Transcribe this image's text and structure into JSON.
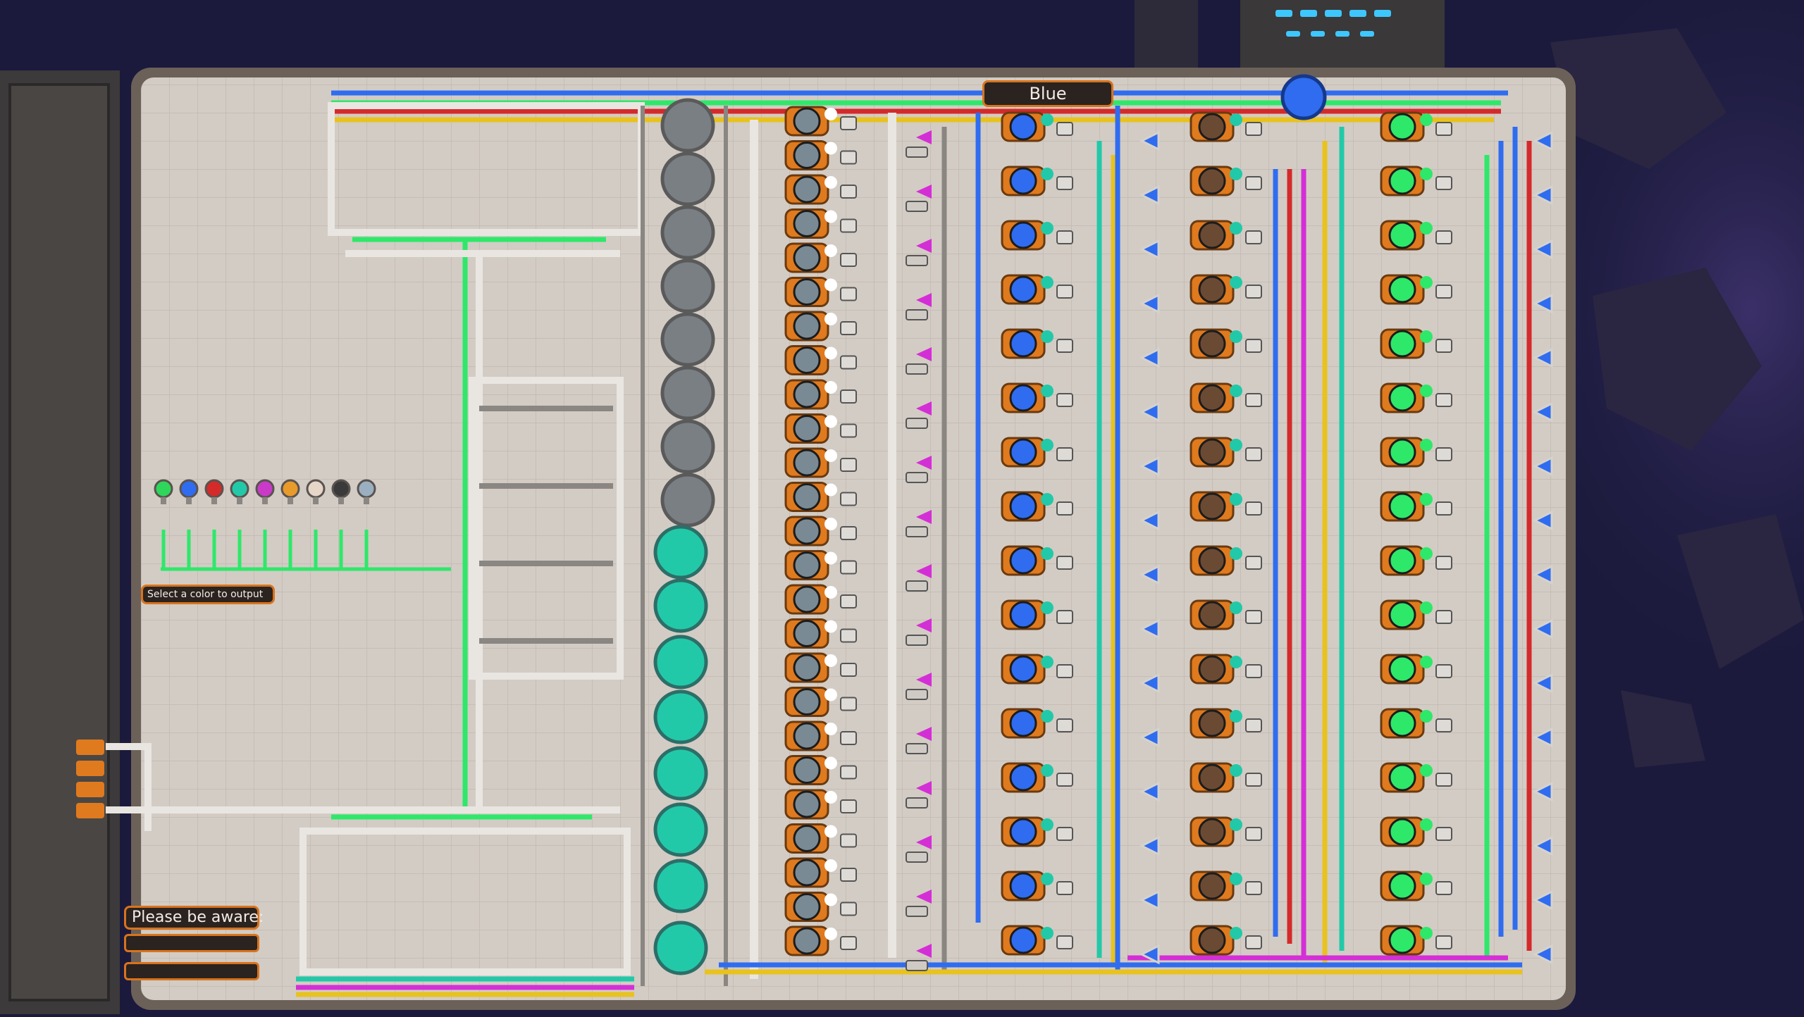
{
  "signs": {
    "color_selected": "Blue",
    "select_prompt": "Select a color to output",
    "warning_title": "Please be aware:",
    "note_1": "",
    "note_2": ""
  },
  "palette": {
    "space": "#1b1a3c",
    "floor": "#cfc8c0",
    "frame": "#6b6158",
    "pipe_white": "#e9e6e2",
    "pipe_green": "#2ee86a",
    "pipe_blue": "#2f6cf0",
    "pipe_red": "#d42a2a",
    "pipe_yellow": "#e8c21e",
    "pipe_magenta": "#d42fd6",
    "pipe_teal": "#22c9a8",
    "machine_orange": "#e07a1e",
    "sign_border": "#d9731c"
  },
  "color_selector": {
    "swatches": [
      "#2ed65a",
      "#2f6cf0",
      "#d42a2a",
      "#22c9a8",
      "#c93ac9",
      "#e89a2a",
      "#e6d6c8",
      "#3a3a3a",
      "#9ab0c0"
    ]
  },
  "icons": {
    "color_swatch": "bulb-icon",
    "tank": "storage-tank-icon",
    "machine": "mixer-machine-icon",
    "sign": "sign-icon"
  }
}
